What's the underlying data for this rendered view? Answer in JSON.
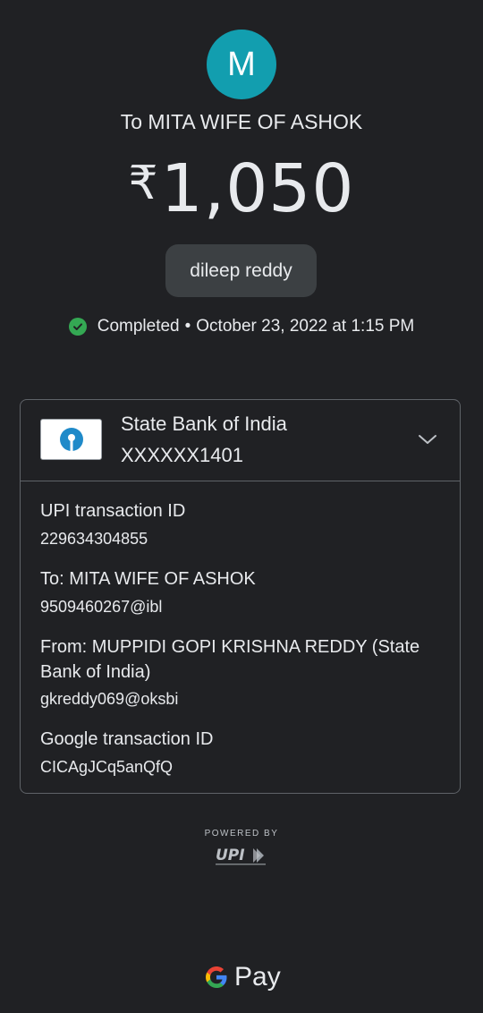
{
  "avatar": {
    "initial": "M",
    "color": "#129eaf"
  },
  "recipient_title": "To MITA WIFE OF ASHOK",
  "amount": {
    "currency": "₹",
    "value": "1,050"
  },
  "note": "dileep reddy",
  "status": {
    "label": "Completed",
    "separator": "•",
    "datetime": "October 23, 2022 at 1:15 PM",
    "color": "#34a853"
  },
  "bank": {
    "name": "State Bank of India",
    "account": "XXXXXX1401",
    "logo_icon": "sbi-logo-icon",
    "expand_icon": "chevron-down-icon"
  },
  "details": {
    "upi_id_label": "UPI transaction ID",
    "upi_id_value": "229634304855",
    "to_label": "To: MITA WIFE OF ASHOK",
    "to_value": "9509460267@ibl",
    "from_label": "From: MUPPIDI  GOPI KRISHNA REDDY (State Bank of India)",
    "from_value": "gkreddy069@oksbi",
    "google_id_label": "Google transaction ID",
    "google_id_value": "CICAgJCq5anQfQ"
  },
  "footer": {
    "powered_by": "POWERED BY",
    "upi_logo_text": "UPI",
    "gpay_text": "Pay"
  },
  "colors": {
    "background": "#202124",
    "text": "#e8eaed",
    "border": "#5f6368",
    "pill": "#3c4043"
  }
}
